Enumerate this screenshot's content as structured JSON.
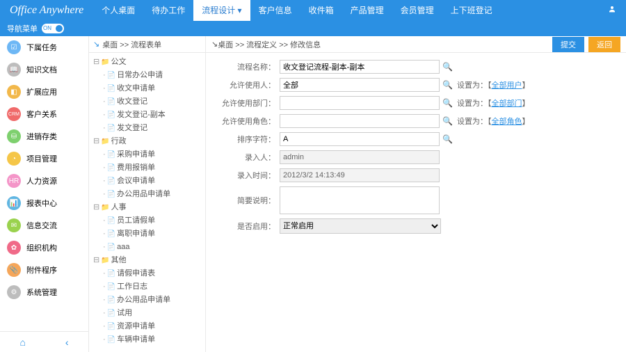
{
  "brand": "Office Anywhere",
  "nav": [
    "个人桌面",
    "待办工作",
    "流程设计",
    "客户信息",
    "收件箱",
    "产品管理",
    "会员管理",
    "上下班登记"
  ],
  "nav_active_index": 2,
  "subbar": {
    "label": "导航菜单",
    "toggle": "ON"
  },
  "side_items": [
    {
      "label": "下属任务",
      "color": "#6db7f5",
      "glyph": "☑"
    },
    {
      "label": "知识文档",
      "color": "#bdbdbd",
      "glyph": "📖"
    },
    {
      "label": "扩展应用",
      "color": "#f2b84b",
      "glyph": "◧"
    },
    {
      "label": "客户关系",
      "color": "#f06a6a",
      "glyph": "CRM"
    },
    {
      "label": "进销存类",
      "color": "#7ed06e",
      "glyph": "⛁"
    },
    {
      "label": "项目管理",
      "color": "#f5c648",
      "glyph": "◔"
    },
    {
      "label": "人力资源",
      "color": "#f495c8",
      "glyph": "HR"
    },
    {
      "label": "报表中心",
      "color": "#60b6e2",
      "glyph": "📊"
    },
    {
      "label": "信息交流",
      "color": "#9ad24e",
      "glyph": "✉"
    },
    {
      "label": "组织机构",
      "color": "#f06a88",
      "glyph": "✿"
    },
    {
      "label": "附件程序",
      "color": "#f5a65a",
      "glyph": "📎"
    },
    {
      "label": "系统管理",
      "color": "#bdbdbd",
      "glyph": "⚙"
    }
  ],
  "mid_crumb": "桌面 >> 流程表单",
  "tree": [
    {
      "label": "公文",
      "type": "fld",
      "open": true,
      "children": [
        {
          "label": "日常办公申请",
          "type": "doc"
        },
        {
          "label": "收文申请单",
          "type": "doc"
        },
        {
          "label": "收文登记",
          "type": "doc"
        },
        {
          "label": "发文登记-副本",
          "type": "doc"
        },
        {
          "label": "发文登记",
          "type": "doc"
        }
      ]
    },
    {
      "label": "行政",
      "type": "fld",
      "open": true,
      "children": [
        {
          "label": "采购申请单",
          "type": "doc"
        },
        {
          "label": "费用报销单",
          "type": "doc"
        },
        {
          "label": "会议申请单",
          "type": "doc"
        },
        {
          "label": "办公用品申请单",
          "type": "doc"
        }
      ]
    },
    {
      "label": "人事",
      "type": "fld",
      "open": true,
      "children": [
        {
          "label": "员工请假单",
          "type": "doc"
        },
        {
          "label": "离职申请单",
          "type": "doc"
        },
        {
          "label": "aaa",
          "type": "doc"
        }
      ]
    },
    {
      "label": "其他",
      "type": "fld",
      "open": true,
      "children": [
        {
          "label": "请假申请表",
          "type": "doc"
        },
        {
          "label": "工作日志",
          "type": "doc"
        },
        {
          "label": "办公用品申请单",
          "type": "doc"
        },
        {
          "label": "试用",
          "type": "doc"
        },
        {
          "label": "资源申请单",
          "type": "doc"
        },
        {
          "label": "车辆申请单",
          "type": "doc"
        }
      ]
    }
  ],
  "main_crumb": "桌面 >> 流程定义 >> 修改信息",
  "buttons": {
    "submit": "提交",
    "back": "返回"
  },
  "form": {
    "name_label": "流程名称：",
    "name_value": "收文登记流程-副本-副本",
    "users_label": "允许使用人：",
    "users_value": "全部",
    "dept_label": "允许使用部门：",
    "dept_value": "",
    "role_label": "允许使用角色：",
    "role_value": "",
    "sort_label": "排序字符：",
    "sort_value": "A",
    "entered_by_label": "录入人：",
    "entered_by_value": "admin",
    "entered_at_label": "录入时间：",
    "entered_at_value": "2012/3/2 14:13:49",
    "desc_label": "简要说明：",
    "desc_value": "",
    "enable_label": "是否启用：",
    "enable_value": "正常启用",
    "set_prefix": "设置为：",
    "link_users": "全部用户",
    "link_dept": "全部部门",
    "link_role": "全部角色",
    "bracket_open": "【",
    "bracket_close": "】"
  }
}
